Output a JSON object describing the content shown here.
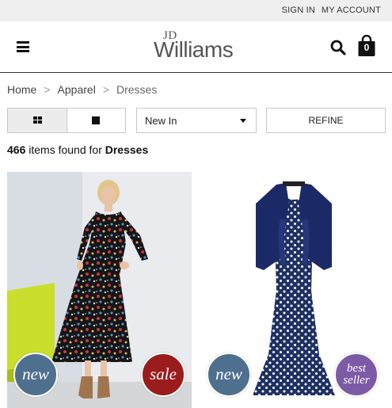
{
  "topbar": {
    "signin": "SIGN IN",
    "account": "MY ACCOUNT"
  },
  "header": {
    "logo_small": "JD",
    "logo_main": "Williams",
    "bag_count": "0"
  },
  "breadcrumb": {
    "home": "Home",
    "sep": ">",
    "apparel": "Apparel",
    "current": "Dresses"
  },
  "toolbar": {
    "sort_value": "New In",
    "refine_label": "REFINE"
  },
  "results": {
    "count": "466",
    "text": "items found for",
    "query": "Dresses"
  },
  "products": [
    {
      "badges": [
        "new",
        "sale"
      ]
    },
    {
      "badges": [
        "new",
        "best seller"
      ]
    }
  ],
  "badges": {
    "new": "new",
    "sale": "sale",
    "best_line1": "best",
    "best_line2": "seller"
  },
  "colors": {
    "badge_new": "#4f6f8f",
    "badge_sale": "#9b1c1c",
    "badge_best": "#7d5aa6",
    "topbar": "#efefef"
  },
  "icons": {
    "menu": "hamburger-icon",
    "search": "search-icon",
    "bag": "shopping-bag-icon",
    "grid": "grid-view-icon",
    "list": "single-view-icon",
    "caret": "chevron-down-icon"
  }
}
